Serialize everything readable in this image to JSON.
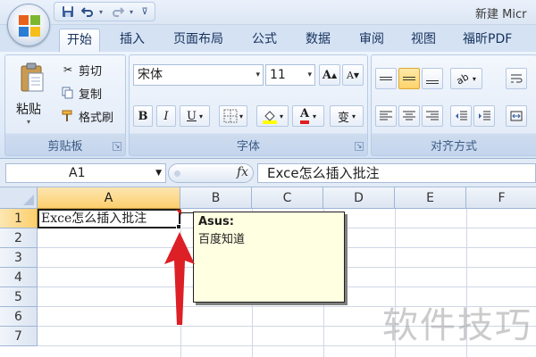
{
  "window": {
    "title": "新建 Micr"
  },
  "quick_access": {
    "save_icon": "save-icon",
    "undo_icon": "undo-icon",
    "redo_icon": "redo-icon",
    "customize_icon": "customize-icon"
  },
  "tabs": [
    {
      "label": "开始",
      "active": true
    },
    {
      "label": "插入"
    },
    {
      "label": "页面布局"
    },
    {
      "label": "公式"
    },
    {
      "label": "数据"
    },
    {
      "label": "审阅"
    },
    {
      "label": "视图"
    },
    {
      "label": "福昕PDF"
    }
  ],
  "clipboard": {
    "paste_label": "粘贴",
    "cut_label": "剪切",
    "copy_label": "复制",
    "format_painter_label": "格式刷",
    "group_label": "剪贴板"
  },
  "font": {
    "font_name": "宋体",
    "font_size": "11",
    "bold": "B",
    "italic": "I",
    "underline": "U",
    "grow": "A",
    "shrink": "A",
    "font_color": "A",
    "phonetic": "变",
    "group_label": "字体"
  },
  "alignment": {
    "group_label": "对齐方式"
  },
  "formula_bar": {
    "name_box": "A1",
    "fx": "fx",
    "content": "Exce怎么插入批注"
  },
  "sheet": {
    "columns": [
      "A",
      "B",
      "C",
      "D",
      "E",
      "F"
    ],
    "rows": [
      "1",
      "2",
      "3",
      "4",
      "5",
      "6",
      "7"
    ],
    "cell_a1": "Exce怎么插入批注",
    "comment": {
      "author": "Asus:",
      "text": "百度知道"
    }
  },
  "watermark": "软件技巧",
  "colors": {
    "accent": "#15315c",
    "selection": "#fbcf6d",
    "comment_bg": "#ffffe1",
    "arrow": "#dd1f26"
  }
}
